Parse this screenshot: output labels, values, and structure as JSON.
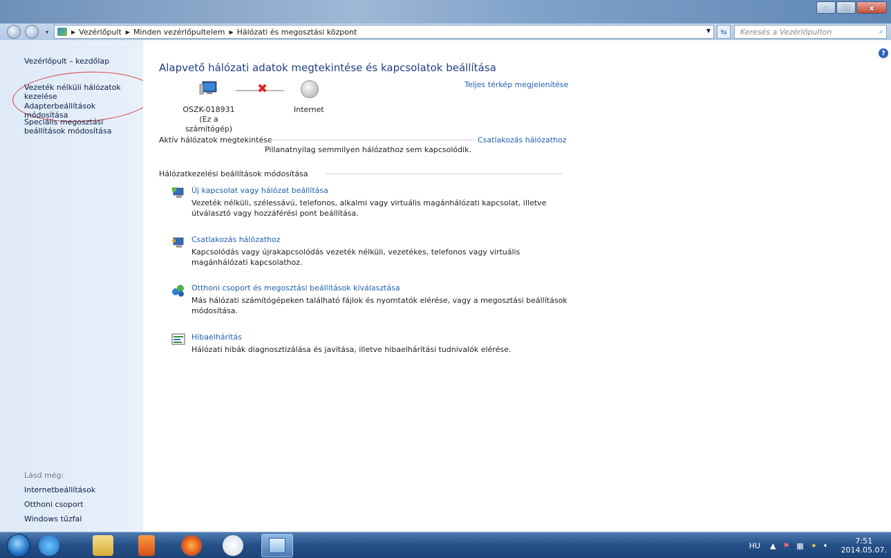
{
  "window": {
    "minimize": "–",
    "maximize": "□",
    "close": "x"
  },
  "address": {
    "crumbs": [
      "Vezérlőpult",
      "Minden vezérlőpultelem",
      "Hálózati és megosztási központ"
    ],
    "search_placeholder": "Keresés a Vezérlőpulton"
  },
  "sidebar": {
    "home": "Vezérlőpult – kezdőlap",
    "items": [
      "Vezeték nélküli hálózatok kezelése",
      "Adapterbeállítások módosítása",
      "Speciális megosztási beállítások módosítása"
    ],
    "see_also_title": "Lásd még:",
    "see_also": [
      "Internetbeállítások",
      "Otthoni csoport",
      "Windows tűzfal"
    ]
  },
  "main": {
    "title": "Alapvető hálózati adatok megtekintése és kapcsolatok beállítása",
    "full_map": "Teljes térkép megjelenítése",
    "computer_name": "OSZK-018931",
    "computer_sub": "(Ez a számítógép)",
    "internet": "Internet",
    "active_heading": "Aktív hálózatok megtekintése",
    "connect_link": "Csatlakozás hálózathoz",
    "not_connected": "Pillanatnyilag semmilyen hálózathoz sem kapcsolódik.",
    "settings_heading": "Hálózatkezelési beállítások módosítása",
    "tasks": [
      {
        "link": "Új kapcsolat vagy hálózat beállítása",
        "desc": "Vezeték nélküli, szélessávú, telefonos, alkalmi vagy virtuális magánhálózati kapcsolat, illetve útválasztó vagy hozzáférési pont beállítása."
      },
      {
        "link": "Csatlakozás hálózathoz",
        "desc": "Kapcsolódás vagy újrakapcsolódás vezeték nélküli, vezetékes, telefonos vagy virtuális magánhálózati kapcsolathoz."
      },
      {
        "link": "Otthoni csoport és megosztási beállítások kiválasztása",
        "desc": "Más hálózati számítógépeken található fájlok és nyomtatók elérése, vagy a megosztási beállítások módosítása."
      },
      {
        "link": "Hibaelhárítás",
        "desc": "Hálózati hibák diagnosztizálása és javítása, illetve hibaelhárítási tudnivalók elérése."
      }
    ]
  },
  "taskbar": {
    "lang": "HU",
    "time": "7:51",
    "date": "2014.05.07."
  }
}
